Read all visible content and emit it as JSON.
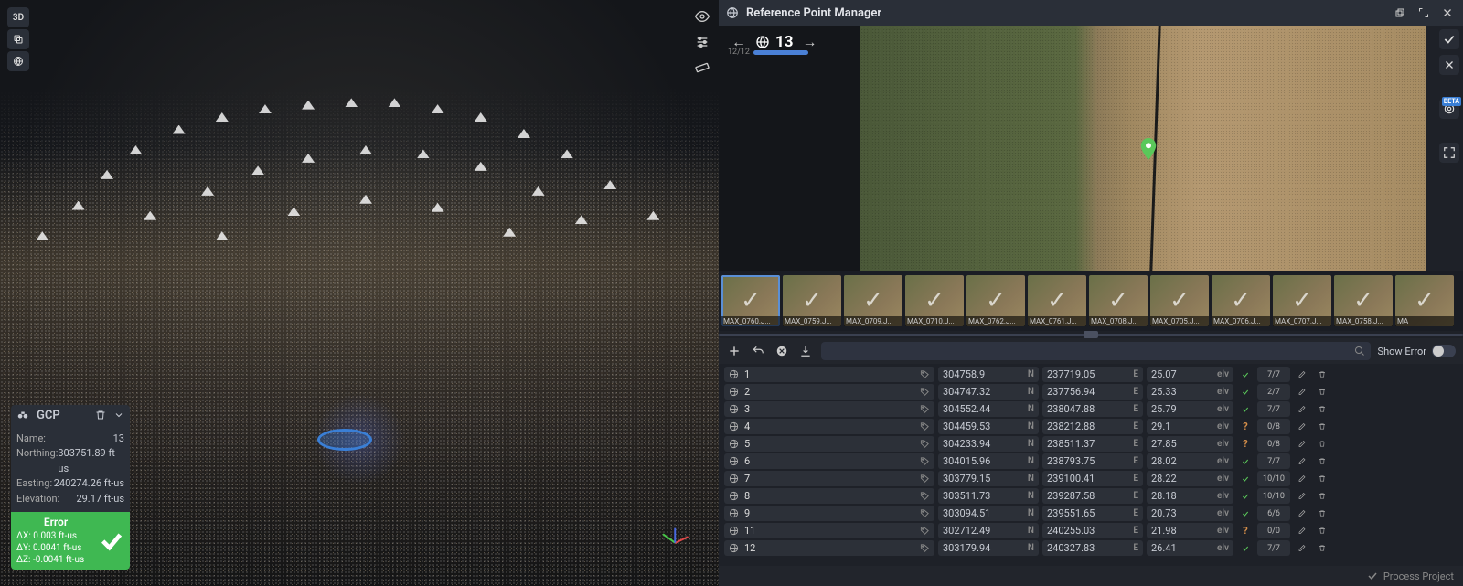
{
  "left_toolbar": {
    "mode_label": "3D"
  },
  "gcp_panel": {
    "title": "GCP",
    "name_label": "Name:",
    "name_value": "13",
    "northing_label": "Northing:",
    "northing_value": "303751.89 ft-us",
    "easting_label": "Easting:",
    "easting_value": "240274.26 ft-us",
    "elevation_label": "Elevation:",
    "elevation_value": "29.17 ft-us",
    "error_title": "Error",
    "dx": "ΔX: 0.003 ft-us",
    "dy": "ΔY: 0.0041 ft-us",
    "dz": "ΔZ: -0.0041 ft-us"
  },
  "rp_header": {
    "title": "Reference Point Manager"
  },
  "counter": {
    "current": "13",
    "progress_label": "12/12"
  },
  "thumbnails": [
    {
      "label": "MAX_0760.J...",
      "active": true
    },
    {
      "label": "MAX_0759.J..."
    },
    {
      "label": "MAX_0709.J..."
    },
    {
      "label": "MAX_0710.J..."
    },
    {
      "label": "MAX_0762.J..."
    },
    {
      "label": "MAX_0761.J..."
    },
    {
      "label": "MAX_0708.J..."
    },
    {
      "label": "MAX_0705.J..."
    },
    {
      "label": "MAX_0706.J..."
    },
    {
      "label": "MAX_0707.J..."
    },
    {
      "label": "MAX_0758.J..."
    },
    {
      "label": "MA"
    }
  ],
  "toolbar": {
    "show_error_label": "Show Error"
  },
  "ref_points": [
    {
      "idx": "1",
      "n": "304758.9",
      "e": "237719.05",
      "elv": "25.07",
      "status": "ok",
      "ratio": "7/7"
    },
    {
      "idx": "2",
      "n": "304747.32",
      "e": "237756.94",
      "elv": "25.33",
      "status": "ok",
      "ratio": "2/7"
    },
    {
      "idx": "3",
      "n": "304552.44",
      "e": "238047.88",
      "elv": "25.79",
      "status": "ok",
      "ratio": "7/7"
    },
    {
      "idx": "4",
      "n": "304459.53",
      "e": "238212.88",
      "elv": "29.1",
      "status": "warn",
      "ratio": "0/8"
    },
    {
      "idx": "5",
      "n": "304233.94",
      "e": "238511.37",
      "elv": "27.85",
      "status": "warn",
      "ratio": "0/8"
    },
    {
      "idx": "6",
      "n": "304015.96",
      "e": "238793.75",
      "elv": "28.02",
      "status": "ok",
      "ratio": "7/7"
    },
    {
      "idx": "7",
      "n": "303779.15",
      "e": "239100.41",
      "elv": "28.22",
      "status": "ok",
      "ratio": "10/10"
    },
    {
      "idx": "8",
      "n": "303511.73",
      "e": "239287.58",
      "elv": "28.18",
      "status": "ok",
      "ratio": "10/10"
    },
    {
      "idx": "9",
      "n": "303094.51",
      "e": "239551.65",
      "elv": "20.73",
      "status": "ok",
      "ratio": "6/6"
    },
    {
      "idx": "11",
      "n": "302712.49",
      "e": "240255.03",
      "elv": "21.98",
      "status": "warn",
      "ratio": "0/0"
    },
    {
      "idx": "12",
      "n": "303179.94",
      "e": "240327.83",
      "elv": "26.41",
      "status": "ok",
      "ratio": "7/7"
    }
  ],
  "footer": {
    "process_label": "Process Project"
  }
}
